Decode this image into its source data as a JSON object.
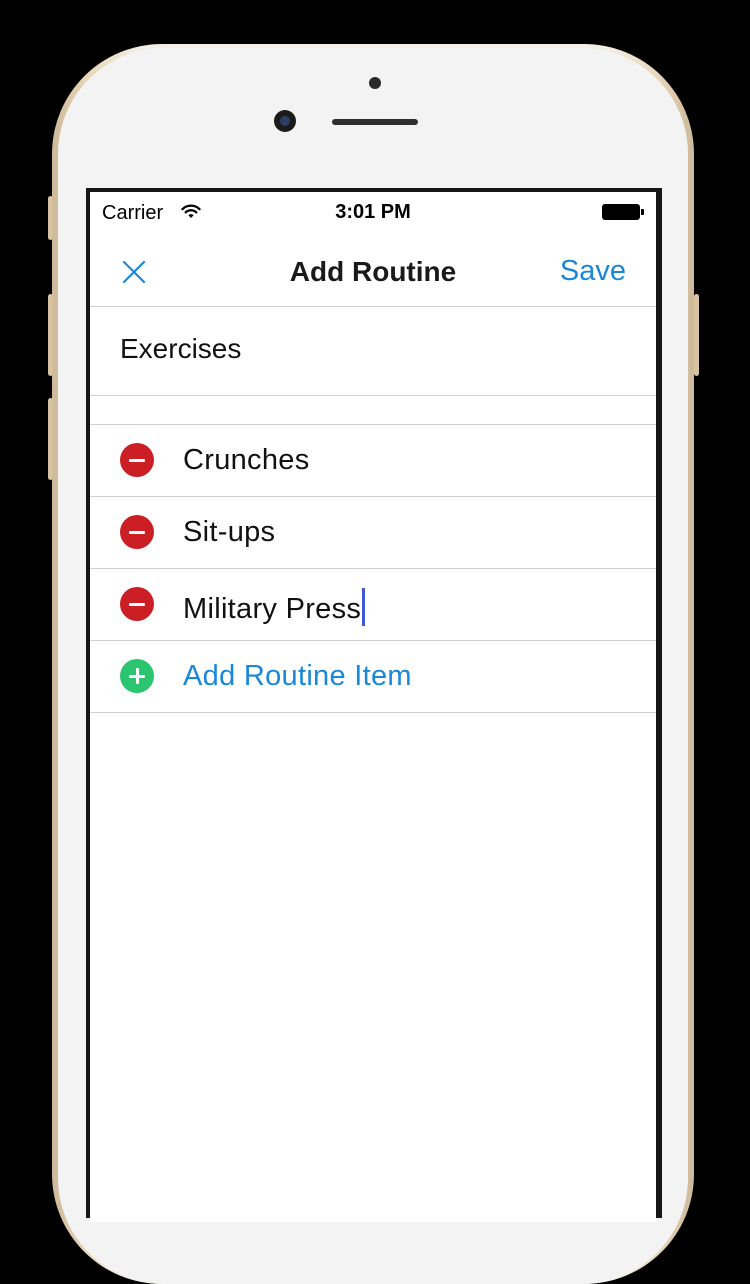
{
  "status_bar": {
    "carrier": "Carrier",
    "wifi_icon": "wifi-icon",
    "time": "3:01 PM",
    "battery_icon": "battery-icon"
  },
  "nav": {
    "close_icon": "close-icon",
    "title": "Add Routine",
    "save_label": "Save"
  },
  "form": {
    "name_value": "Exercises"
  },
  "routine_items": [
    {
      "label": "Crunches",
      "action": "delete"
    },
    {
      "label": "Sit-ups",
      "action": "delete"
    },
    {
      "label": "Military Press",
      "action": "delete",
      "editing": true
    }
  ],
  "add_item_label": "Add Routine Item",
  "colors": {
    "accent": "#1a87d9",
    "delete": "#cc1f25",
    "add": "#2bc46f",
    "caret": "#4255d6"
  }
}
